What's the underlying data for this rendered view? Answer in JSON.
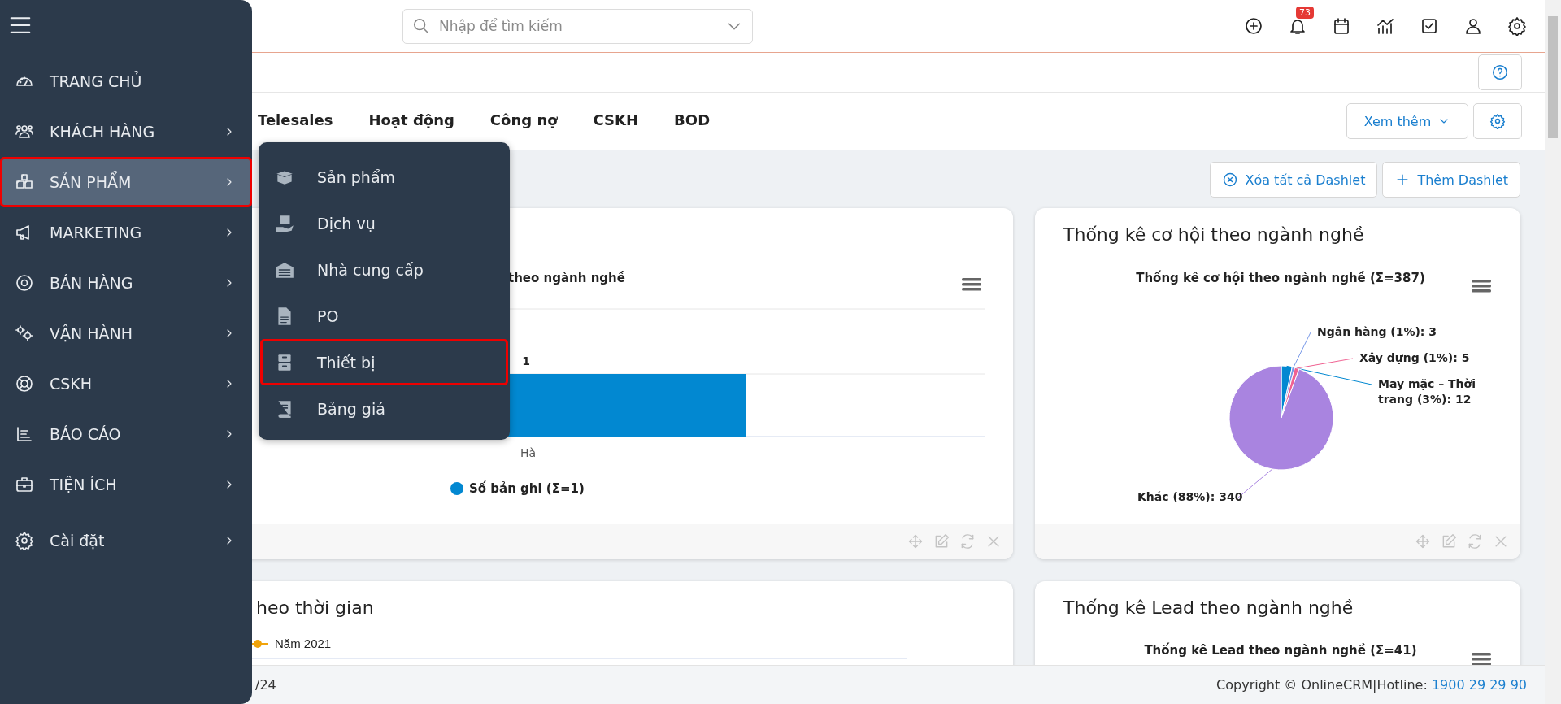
{
  "sidebar": {
    "items": [
      {
        "label": "TRANG CHỦ",
        "expandable": false,
        "selected": false
      },
      {
        "label": "KHÁCH HÀNG",
        "expandable": true,
        "selected": false
      },
      {
        "label": "SẢN PHẨM",
        "expandable": true,
        "selected": true
      },
      {
        "label": "MARKETING",
        "expandable": true,
        "selected": false
      },
      {
        "label": "BÁN HÀNG",
        "expandable": true,
        "selected": false
      },
      {
        "label": "VẬN HÀNH",
        "expandable": true,
        "selected": false
      },
      {
        "label": "CSKH",
        "expandable": true,
        "selected": false
      },
      {
        "label": "BÁO CÁO",
        "expandable": true,
        "selected": false
      },
      {
        "label": "TIỆN ÍCH",
        "expandable": true,
        "selected": false
      }
    ],
    "settings_item": {
      "label": "Cài đặt",
      "expandable": true
    }
  },
  "submenu": {
    "items": [
      {
        "label": "Sản phẩm",
        "selected": false
      },
      {
        "label": "Dịch vụ",
        "selected": false
      },
      {
        "label": "Nhà cung cấp",
        "selected": false
      },
      {
        "label": "PO",
        "selected": false
      },
      {
        "label": "Thiết bị",
        "selected": true
      },
      {
        "label": "Bảng giá",
        "selected": false
      }
    ]
  },
  "search": {
    "placeholder": "Nhập để tìm kiếm"
  },
  "notifications": {
    "badge": "73"
  },
  "tabs": [
    {
      "label": "Telesales",
      "selected": false
    },
    {
      "label": "Hoạt động",
      "selected": false
    },
    {
      "label": "Công nợ",
      "selected": false
    },
    {
      "label": "CSKH",
      "selected": false
    },
    {
      "label": "BOD",
      "selected": false
    }
  ],
  "more_button": "Xem thêm",
  "dashlet_actions": [
    "Xóa tất cả Dashlet",
    "Thêm Dashlet"
  ],
  "dashlets": [
    {
      "kind": "bar",
      "chart_title": "theo ngành nghề",
      "bar_label": "1",
      "category": "Hà",
      "legend": [
        {
          "label": "Số bản ghi (Σ=1)",
          "color": "#0288d1"
        }
      ]
    },
    {
      "title": "Thống kê cơ hội theo ngành nghề",
      "chart_data": {
        "type": "pie",
        "title": "Thống kê cơ hội theo ngành nghề (Σ=387)",
        "values": [
          12,
          3,
          5,
          340
        ],
        "value_labels": [
          "May mặc – Thời trang (3%): 12",
          "Ngân hàng (1%): 3",
          "Xây dựng (1%): 5",
          "Khác (88%): 340"
        ]
      }
    },
    {
      "kind": "line",
      "title": "heo thời gian",
      "legend": [
        {
          "label": "Năm 2021",
          "color": "#f0a30a"
        }
      ]
    },
    {
      "kind": "pie_top",
      "title": "Thống kê Lead theo ngành nghề",
      "chart_title": "Thống kê Lead theo ngành nghề (Σ=41)"
    }
  ],
  "footer": {
    "left": "/24",
    "copyright": "Copyright © OnlineCRM|Hotline: ",
    "hotline": "1900 29 29 90"
  }
}
